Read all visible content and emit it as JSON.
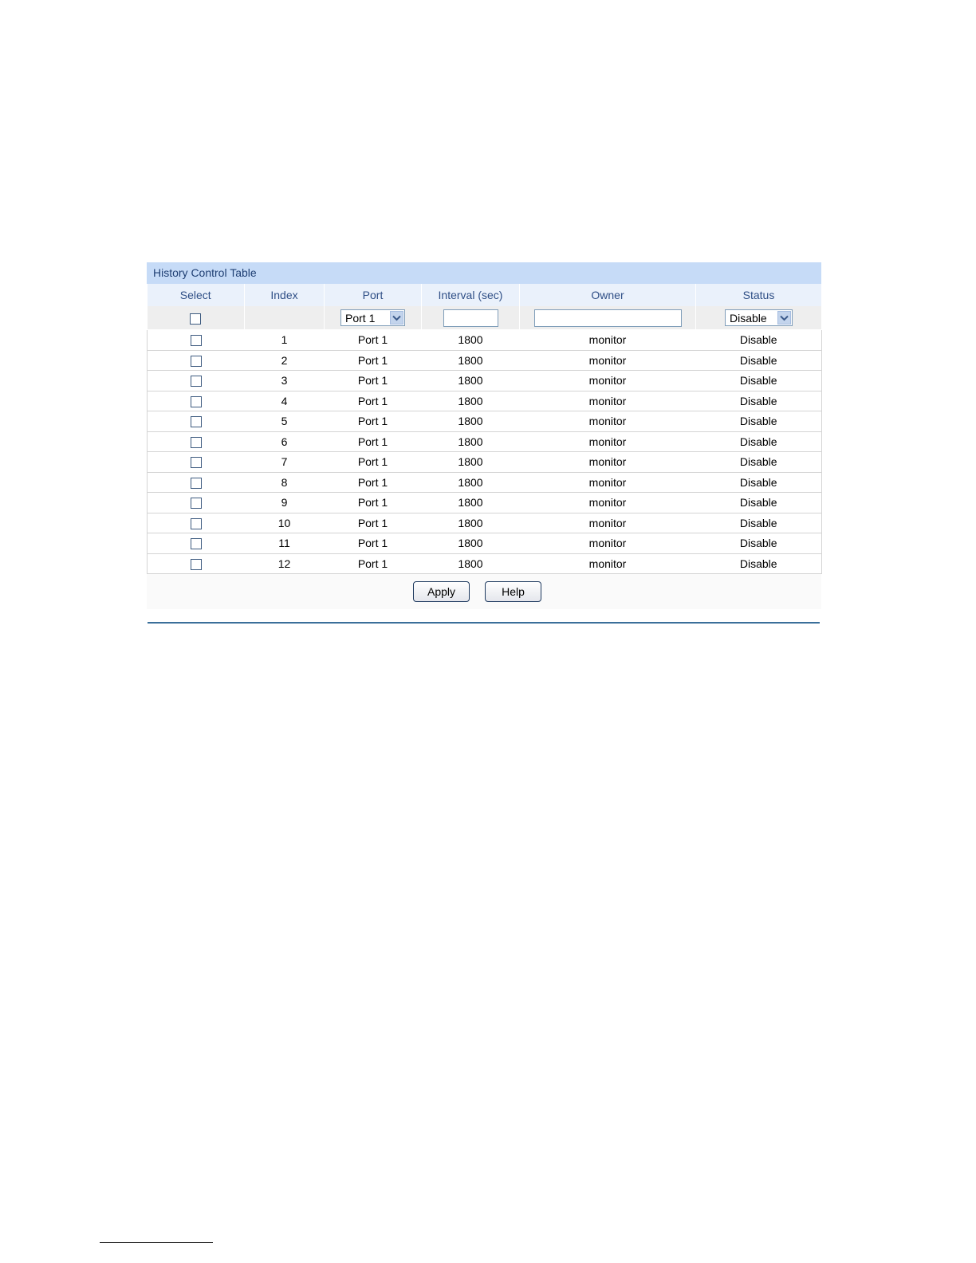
{
  "table": {
    "title": "History Control Table",
    "columns": [
      "Select",
      "Index",
      "Port",
      "Interval (sec)",
      "Owner",
      "Status"
    ],
    "edit_row": {
      "port_selected": "Port 1",
      "interval_value": "",
      "owner_value": "",
      "status_selected": "Disable"
    },
    "rows": [
      {
        "index": "1",
        "port": "Port 1",
        "interval": "1800",
        "owner": "monitor",
        "status": "Disable"
      },
      {
        "index": "2",
        "port": "Port 1",
        "interval": "1800",
        "owner": "monitor",
        "status": "Disable"
      },
      {
        "index": "3",
        "port": "Port 1",
        "interval": "1800",
        "owner": "monitor",
        "status": "Disable"
      },
      {
        "index": "4",
        "port": "Port 1",
        "interval": "1800",
        "owner": "monitor",
        "status": "Disable"
      },
      {
        "index": "5",
        "port": "Port 1",
        "interval": "1800",
        "owner": "monitor",
        "status": "Disable"
      },
      {
        "index": "6",
        "port": "Port 1",
        "interval": "1800",
        "owner": "monitor",
        "status": "Disable"
      },
      {
        "index": "7",
        "port": "Port 1",
        "interval": "1800",
        "owner": "monitor",
        "status": "Disable"
      },
      {
        "index": "8",
        "port": "Port 1",
        "interval": "1800",
        "owner": "monitor",
        "status": "Disable"
      },
      {
        "index": "9",
        "port": "Port 1",
        "interval": "1800",
        "owner": "monitor",
        "status": "Disable"
      },
      {
        "index": "10",
        "port": "Port 1",
        "interval": "1800",
        "owner": "monitor",
        "status": "Disable"
      },
      {
        "index": "11",
        "port": "Port 1",
        "interval": "1800",
        "owner": "monitor",
        "status": "Disable"
      },
      {
        "index": "12",
        "port": "Port 1",
        "interval": "1800",
        "owner": "monitor",
        "status": "Disable"
      }
    ]
  },
  "buttons": {
    "apply_label": "Apply",
    "help_label": "Help"
  },
  "icons": {
    "dropdown": "chevron-down-icon"
  },
  "colors": {
    "title_bar_bg": "#c6dbf7",
    "title_text": "#1f3f73",
    "header_bg": "#eaf1fb",
    "header_text": "#2f4f86",
    "rule": "#3a6f9a"
  }
}
